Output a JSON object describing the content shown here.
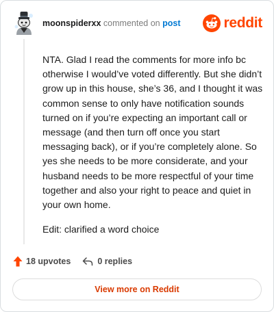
{
  "header": {
    "username": "moonspiderxx",
    "commented_text": "commented on",
    "post_link": "post",
    "brand": "reddit"
  },
  "comment": {
    "body": "NTA. Glad I read the comments for more info bc otherwise I would’ve voted differently. But she didn’t grow up in this house, she’s 36, and I thought it was common sense to only have notification sounds turned on if you’re expecting an important call or message (and then turn off once you start messaging back), or if you’re completely alone. So yes she needs to be more considerate, and your husband needs to be more respectful of your time together and also your right to peace and quiet in your own home.",
    "edit": "Edit: clarified a word choice"
  },
  "actions": {
    "upvotes": "18 upvotes",
    "replies": "0 replies"
  },
  "footer": {
    "view_more": "View more on Reddit"
  },
  "colors": {
    "brand": "#ff4500",
    "link": "#0079d3",
    "view_more": "#d93a00"
  },
  "icons": {
    "avatar": "snoo-avatar-icon",
    "logo": "reddit-logo-icon",
    "upvote": "upvote-arrow-icon",
    "reply": "reply-arrow-icon"
  }
}
